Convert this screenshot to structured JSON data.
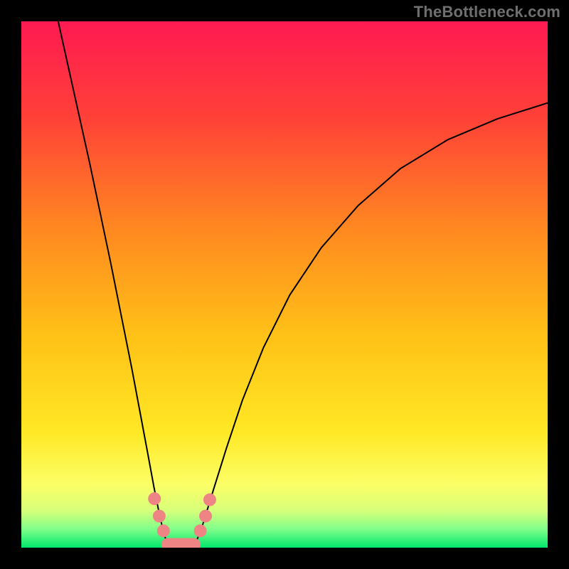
{
  "watermark": "TheBottleneck.com",
  "chart_data": {
    "type": "line",
    "title": "",
    "xlabel": "",
    "ylabel": "",
    "xlim": [
      0,
      1
    ],
    "ylim": [
      0,
      1
    ],
    "background_gradient": {
      "stops": [
        {
          "offset": 0.0,
          "color": "#ff1a52"
        },
        {
          "offset": 0.18,
          "color": "#ff4038"
        },
        {
          "offset": 0.4,
          "color": "#ff8a20"
        },
        {
          "offset": 0.6,
          "color": "#ffc217"
        },
        {
          "offset": 0.78,
          "color": "#ffe825"
        },
        {
          "offset": 0.88,
          "color": "#fbff66"
        },
        {
          "offset": 0.93,
          "color": "#d6ff7a"
        },
        {
          "offset": 0.965,
          "color": "#7fff8a"
        },
        {
          "offset": 1.0,
          "color": "#00e66b"
        }
      ]
    },
    "series": [
      {
        "name": "left-curve",
        "color": "#000000",
        "width": 2,
        "x": [
          0.07,
          0.09,
          0.11,
          0.13,
          0.15,
          0.17,
          0.19,
          0.21,
          0.225,
          0.24,
          0.252,
          0.262,
          0.27,
          0.278
        ],
        "y": [
          1.0,
          0.91,
          0.82,
          0.73,
          0.635,
          0.54,
          0.44,
          0.34,
          0.26,
          0.18,
          0.115,
          0.065,
          0.03,
          0.005
        ]
      },
      {
        "name": "right-curve",
        "color": "#000000",
        "width": 2,
        "x": [
          0.33,
          0.345,
          0.365,
          0.39,
          0.42,
          0.46,
          0.51,
          0.57,
          0.64,
          0.72,
          0.81,
          0.905,
          1.0
        ],
        "y": [
          0.005,
          0.045,
          0.11,
          0.19,
          0.28,
          0.38,
          0.48,
          0.57,
          0.65,
          0.72,
          0.775,
          0.815,
          0.845
        ]
      }
    ],
    "floor": {
      "y": 0.0,
      "color": "#00e66b"
    },
    "markers": {
      "color": "#ef8484",
      "radius": 9,
      "pill_radius": 9,
      "points": [
        {
          "x": 0.253,
          "y": 0.093
        },
        {
          "x": 0.262,
          "y": 0.06
        },
        {
          "x": 0.27,
          "y": 0.032
        },
        {
          "x": 0.34,
          "y": 0.032
        },
        {
          "x": 0.35,
          "y": 0.06
        },
        {
          "x": 0.358,
          "y": 0.091
        }
      ],
      "pill": {
        "x0": 0.278,
        "x1": 0.328,
        "y": 0.006
      }
    }
  }
}
